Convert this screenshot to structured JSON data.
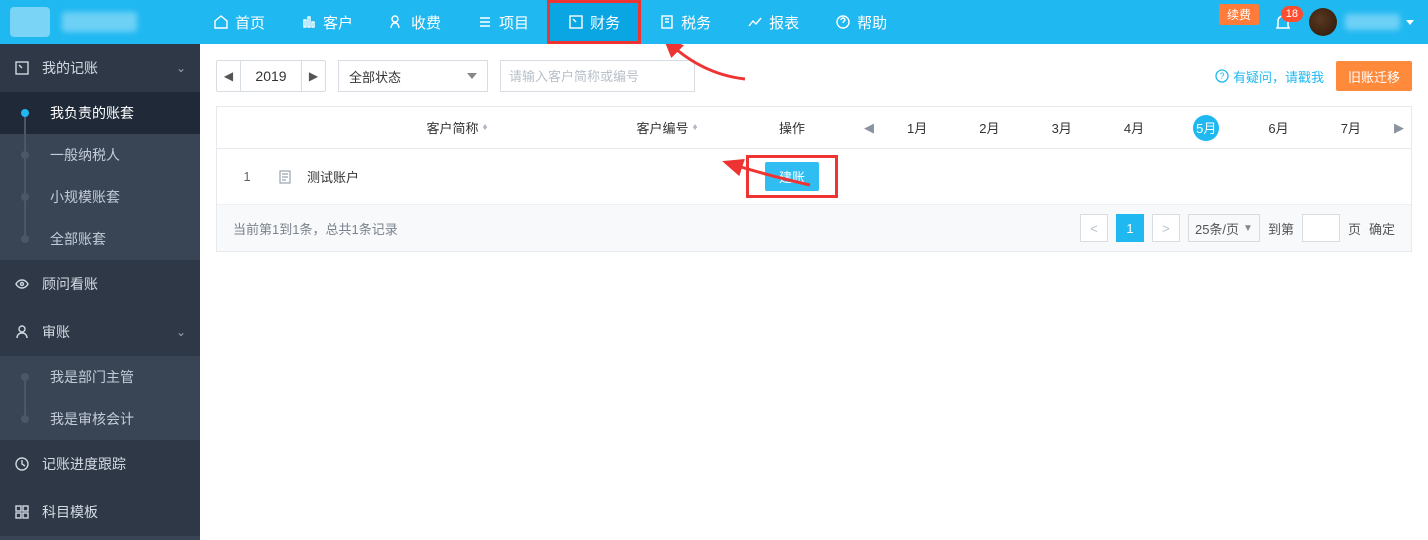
{
  "nav": {
    "items": [
      {
        "label": "首页"
      },
      {
        "label": "客户"
      },
      {
        "label": "收费"
      },
      {
        "label": "项目"
      },
      {
        "label": "财务"
      },
      {
        "label": "税务"
      },
      {
        "label": "报表"
      },
      {
        "label": "帮助"
      }
    ],
    "renew": "续费",
    "badge": "18"
  },
  "sidebar": {
    "g1": {
      "label": "我的记账"
    },
    "g1items": [
      {
        "label": "我负责的账套"
      },
      {
        "label": "一般纳税人"
      },
      {
        "label": "小规模账套"
      },
      {
        "label": "全部账套"
      }
    ],
    "g2": {
      "label": "顾问看账"
    },
    "g3": {
      "label": "审账"
    },
    "g3items": [
      {
        "label": "我是部门主管"
      },
      {
        "label": "我是审核会计"
      }
    ],
    "g4": {
      "label": "记账进度跟踪"
    },
    "g5": {
      "label": "科目模板"
    }
  },
  "toolbar": {
    "year": "2019",
    "status": "全部状态",
    "search_placeholder": "请输入客户简称或编号",
    "help": "有疑问，请戳我",
    "migrate": "旧账迁移"
  },
  "table": {
    "headers": {
      "name": "客户简称",
      "code": "客户编号",
      "op": "操作",
      "months": [
        "1月",
        "2月",
        "3月",
        "4月",
        "5月",
        "6月",
        "7月"
      ],
      "active_month_index": 4
    },
    "rows": [
      {
        "idx": "1",
        "name": "测试账户",
        "op": "建账"
      }
    ],
    "footer": {
      "summary": "当前第1到1条，总共1条记录",
      "page": "1",
      "pagesize": "25条/页",
      "goto_prefix": "到第",
      "goto_suffix": "页",
      "confirm": "确定"
    }
  }
}
